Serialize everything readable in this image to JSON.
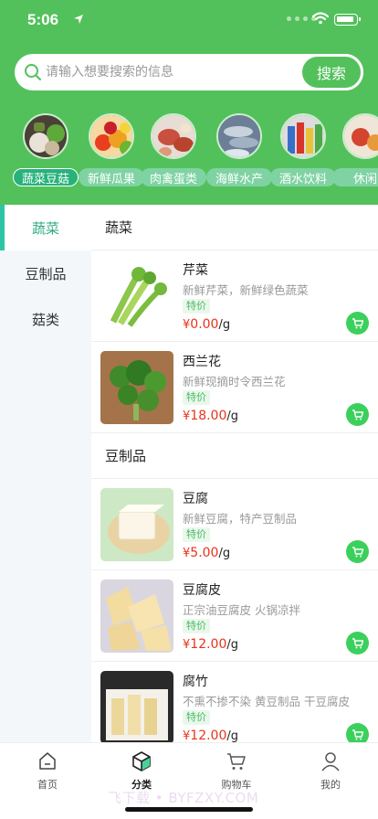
{
  "status_bar": {
    "time": "5:06"
  },
  "search": {
    "placeholder": "请输入想要搜索的信息",
    "button_label": "搜索"
  },
  "categories": [
    {
      "label": "蔬菜豆菇",
      "active": true
    },
    {
      "label": "新鲜瓜果"
    },
    {
      "label": "肉禽蛋类"
    },
    {
      "label": "海鲜水产"
    },
    {
      "label": "酒水饮料"
    },
    {
      "label": "休闲"
    }
  ],
  "side_nav": [
    {
      "label": "蔬菜",
      "active": true
    },
    {
      "label": "豆制品"
    },
    {
      "label": "菇类"
    }
  ],
  "sections": [
    {
      "title": "蔬菜",
      "products": [
        {
          "name": "芹菜",
          "desc": "新鲜芹菜，新鲜绿色蔬菜",
          "tag": "特价",
          "currency": "¥",
          "price": "0.00",
          "unit": "/g"
        },
        {
          "name": "西兰花",
          "desc": "新鲜现摘时令西兰花",
          "tag": "特价",
          "currency": "¥",
          "price": "18.00",
          "unit": "/g"
        }
      ]
    },
    {
      "title": "豆制品",
      "products": [
        {
          "name": "豆腐",
          "desc": "新鲜豆腐，特产豆制品",
          "tag": "特价",
          "currency": "¥",
          "price": "5.00",
          "unit": "/g"
        },
        {
          "name": "豆腐皮",
          "desc": "正宗油豆腐皮 火锅凉拌",
          "tag": "特价",
          "currency": "¥",
          "price": "12.00",
          "unit": "/g"
        },
        {
          "name": "腐竹",
          "desc": "不熏不掺不染 黄豆制品 干豆腐皮",
          "tag": "特价",
          "currency": "¥",
          "price": "12.00",
          "unit": "/g"
        }
      ]
    }
  ],
  "tab_bar": [
    {
      "label": "首页",
      "icon": "home-icon"
    },
    {
      "label": "分类",
      "icon": "category-cube-icon",
      "active": true
    },
    {
      "label": "购物车",
      "icon": "cart-icon"
    },
    {
      "label": "我的",
      "icon": "user-icon"
    }
  ],
  "watermark": "飞下载 • BYFZXY.COM",
  "colors": {
    "brand_green": "#53c15b",
    "price_red": "#e8331b",
    "cart_green": "#3bd05c",
    "active_teal": "#2dc5a5"
  }
}
